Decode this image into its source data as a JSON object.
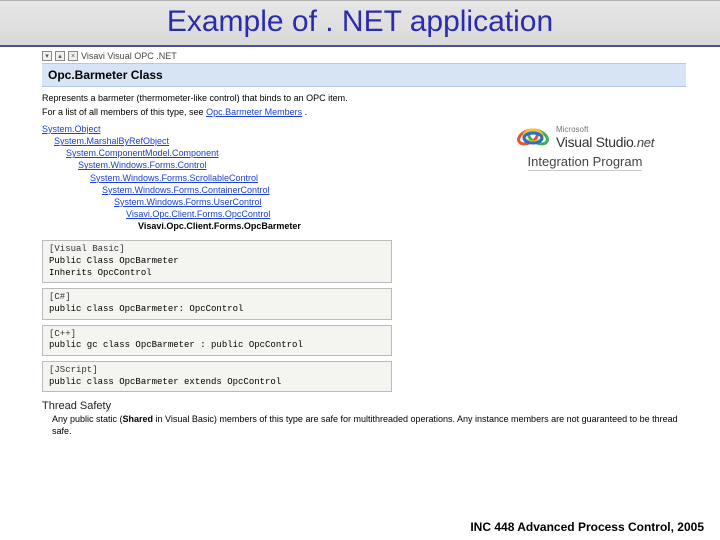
{
  "slide": {
    "title": "Example of . NET application"
  },
  "toolbar": {
    "product_label": "Visavi Visual OPC .NET"
  },
  "class_header": "Opc.Barmeter Class",
  "description": "Represents a barmeter (thermometer-like control) that binds to an OPC item.",
  "members_text_prefix": "For a list of all members of this type, see ",
  "members_link": "Opc.Barmeter Members",
  "members_text_suffix": ".",
  "hierarchy": [
    "System.Object",
    "System.MarshalByRefObject",
    "System.ComponentModel.Component",
    "System.Windows.Forms.Control",
    "System.Windows.Forms.ScrollableControl",
    "System.Windows.Forms.ContainerControl",
    "System.Windows.Forms.UserControl",
    "Visavi.Opc.Client.Forms.OpcControl",
    "Visavi.Opc.Client.Forms.OpcBarmeter"
  ],
  "code_blocks": [
    {
      "lang": "[Visual Basic]",
      "lines": [
        "Public Class OpcBarmeter",
        "  Inherits OpcControl"
      ]
    },
    {
      "lang": "[C#]",
      "lines": [
        "public class OpcBarmeter: OpcControl"
      ]
    },
    {
      "lang": "[C++]",
      "lines": [
        "public   gc class OpcBarmeter : public OpcControl"
      ]
    },
    {
      "lang": "[JScript]",
      "lines": [
        "public class OpcBarmeter extends OpcControl"
      ]
    }
  ],
  "thread_safety": {
    "heading": "Thread Safety",
    "body_prefix": "Any public static (",
    "body_shared": "Shared",
    "body_mid": " in Visual Basic) members of this type are safe for multithreaded operations. Any instance members are not guaranteed to be thread safe."
  },
  "vs_badge": {
    "ms": "Microsoft",
    "vs": "Visual Studio",
    "net": ".net",
    "program": "Integration Program"
  },
  "footer": "INC 448 Advanced Process Control, 2005"
}
